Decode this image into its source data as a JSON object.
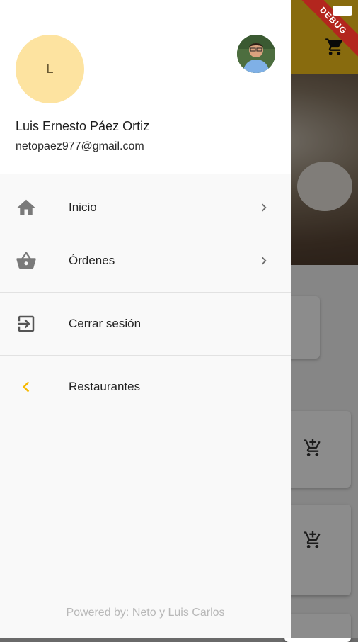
{
  "debug_banner": "DEBUG",
  "drawer": {
    "avatar_initial": "L",
    "user_name": "Luis Ernesto Páez Ortiz",
    "user_email": "netopaez977@gmail.com",
    "menu": [
      {
        "label": "Inicio",
        "icon": "home-icon"
      },
      {
        "label": "Órdenes",
        "icon": "basket-icon"
      },
      {
        "label": "Cerrar sesión",
        "icon": "logout-icon"
      },
      {
        "label": "Restaurantes",
        "icon": "chevron-left-icon"
      }
    ],
    "footer": "Powered by: Neto y Luis Carlos"
  },
  "colors": {
    "accent": "#f7c31b",
    "icon_gray": "#7a7a7a"
  }
}
